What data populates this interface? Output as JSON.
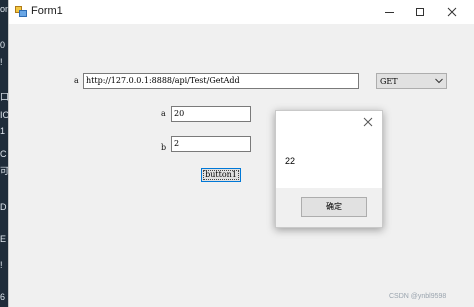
{
  "window": {
    "title": "Form1",
    "icon": "winforms-app-icon",
    "controls": [
      "minimize-icon",
      "maximize-icon",
      "close-icon"
    ]
  },
  "form": {
    "url_label": "a",
    "url_value": "http://127.0.0.1:8888/api/Test/GetAdd",
    "method_selected": "GET",
    "a_label": "a",
    "a_value": "20",
    "b_label": "b",
    "b_value": "2",
    "button_label": "button1"
  },
  "message_box": {
    "text": "22",
    "ok_label": "确定",
    "close_icon": "close-icon"
  },
  "background_strip_glyphs": [
    "on",
    "0",
    "!",
    "口",
    "IO",
    "1",
    "C",
    "可",
    "D",
    "E",
    "!",
    "6"
  ],
  "watermark": "CSDN @ynbl9598"
}
